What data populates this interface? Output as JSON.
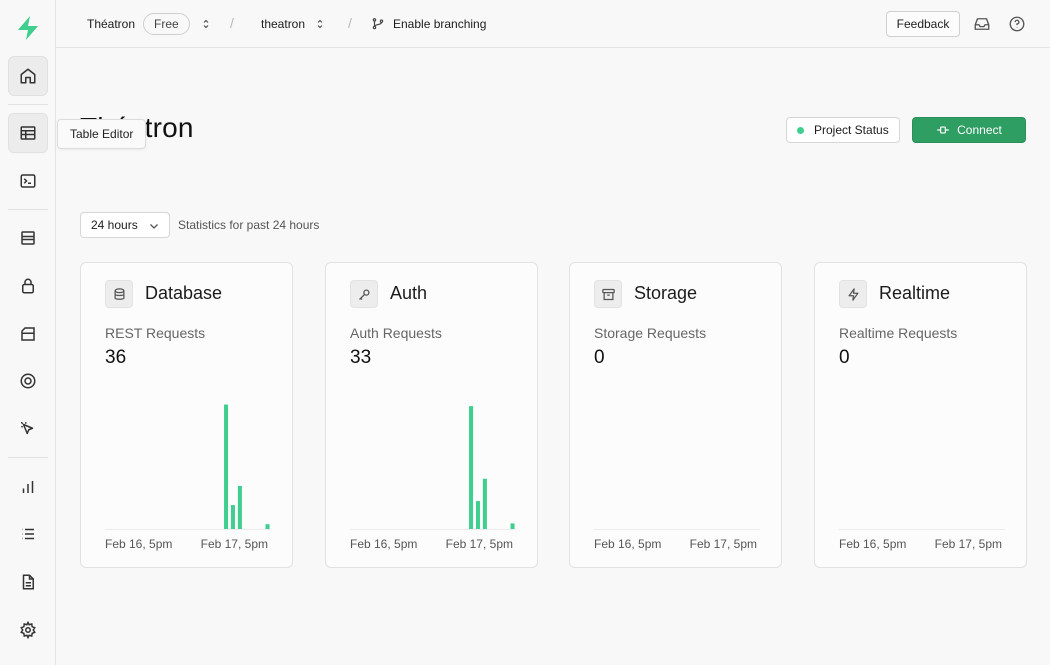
{
  "topbar": {
    "org_name": "Théatron",
    "plan_badge": "Free",
    "project_name": "theatron",
    "branching_label": "Enable branching",
    "feedback_label": "Feedback",
    "separator": "/"
  },
  "sidebar": {
    "items": [
      {
        "name": "home",
        "icon": "home-icon",
        "active": true
      },
      {
        "name": "table-editor",
        "icon": "table-icon"
      },
      {
        "name": "sql-editor",
        "icon": "terminal-icon"
      },
      {
        "name": "database",
        "icon": "database-icon"
      },
      {
        "name": "auth",
        "icon": "lock-icon"
      },
      {
        "name": "storage",
        "icon": "archive-icon"
      },
      {
        "name": "realtime",
        "icon": "lifebuoy-icon"
      },
      {
        "name": "edge-functions",
        "icon": "cursor-icon"
      },
      {
        "name": "reports",
        "icon": "bar-chart-icon"
      },
      {
        "name": "logs",
        "icon": "list-icon"
      },
      {
        "name": "api-docs",
        "icon": "document-icon"
      },
      {
        "name": "settings",
        "icon": "gear-icon"
      }
    ],
    "tooltip": "Table Editor"
  },
  "main": {
    "title": "Théatron",
    "project_status_label": "Project Status",
    "connect_label": "Connect",
    "range_value": "24 hours",
    "range_note": "Statistics for past 24 hours"
  },
  "colors": {
    "accent": "#3ecf8e",
    "connect_bg": "#2f9e63",
    "background": "#f8f8f8"
  },
  "cards": [
    {
      "title": "Database",
      "icon": "database-icon",
      "metric_label": "REST Requests",
      "metric_value": "36",
      "x_start": "Feb 16, 5pm",
      "x_end": "Feb 17, 5pm"
    },
    {
      "title": "Auth",
      "icon": "key-icon",
      "metric_label": "Auth Requests",
      "metric_value": "33",
      "x_start": "Feb 16, 5pm",
      "x_end": "Feb 17, 5pm"
    },
    {
      "title": "Storage",
      "icon": "archive-icon",
      "metric_label": "Storage Requests",
      "metric_value": "0",
      "x_start": "Feb 16, 5pm",
      "x_end": "Feb 17, 5pm"
    },
    {
      "title": "Realtime",
      "icon": "zap-icon",
      "metric_label": "Realtime Requests",
      "metric_value": "0",
      "x_start": "Feb 16, 5pm",
      "x_end": "Feb 17, 5pm"
    }
  ],
  "chart_data": [
    {
      "type": "bar",
      "title": "REST Requests",
      "xlabel": "",
      "ylabel": "",
      "x_start": "Feb 16, 5pm",
      "x_end": "Feb 17, 5pm",
      "bins": 24,
      "values": [
        0,
        0,
        0,
        0,
        0,
        0,
        0,
        0,
        0,
        0,
        0,
        0,
        0,
        0,
        0,
        0,
        0,
        26,
        5,
        9,
        0,
        0,
        0,
        1
      ],
      "ylim": [
        0,
        28
      ]
    },
    {
      "type": "bar",
      "title": "Auth Requests",
      "xlabel": "",
      "ylabel": "",
      "x_start": "Feb 16, 5pm",
      "x_end": "Feb 17, 5pm",
      "bins": 24,
      "values": [
        0,
        0,
        0,
        0,
        0,
        0,
        0,
        0,
        0,
        0,
        0,
        0,
        0,
        0,
        0,
        0,
        0,
        22,
        5,
        9,
        0,
        0,
        0,
        1
      ],
      "ylim": [
        0,
        24
      ]
    },
    {
      "type": "bar",
      "title": "Storage Requests",
      "xlabel": "",
      "ylabel": "",
      "x_start": "Feb 16, 5pm",
      "x_end": "Feb 17, 5pm",
      "bins": 24,
      "values": [
        0,
        0,
        0,
        0,
        0,
        0,
        0,
        0,
        0,
        0,
        0,
        0,
        0,
        0,
        0,
        0,
        0,
        0,
        0,
        0,
        0,
        0,
        0,
        0
      ],
      "ylim": [
        0,
        1
      ]
    },
    {
      "type": "bar",
      "title": "Realtime Requests",
      "xlabel": "",
      "ylabel": "",
      "x_start": "Feb 16, 5pm",
      "x_end": "Feb 17, 5pm",
      "bins": 24,
      "values": [
        0,
        0,
        0,
        0,
        0,
        0,
        0,
        0,
        0,
        0,
        0,
        0,
        0,
        0,
        0,
        0,
        0,
        0,
        0,
        0,
        0,
        0,
        0,
        0
      ],
      "ylim": [
        0,
        1
      ]
    }
  ]
}
